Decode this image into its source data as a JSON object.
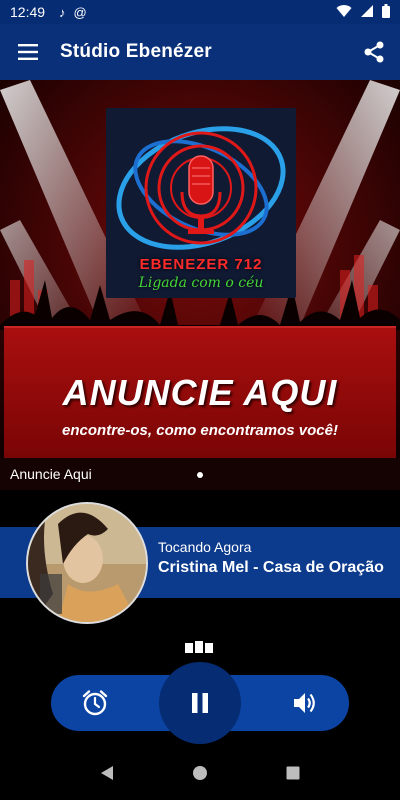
{
  "status_bar": {
    "time": "12:49",
    "icons": [
      "music-note-icon",
      "at-icon",
      "wifi-icon",
      "signal-icon",
      "battery-icon"
    ]
  },
  "app_bar": {
    "title": "Stúdio Ebenézer",
    "menu_icon": "hamburger-menu-icon",
    "share_icon": "share-icon"
  },
  "hero": {
    "logo_brand": "EBENEZER 712",
    "logo_tagline": "Ligada com o céu",
    "ad_title": "ANUNCIE AQUI",
    "ad_subtitle": "encontre-os, como encontramos você!",
    "caption": "Anuncie Aqui",
    "slide_index": 1
  },
  "now_playing": {
    "label": "Tocando Agora",
    "track": "Cristina Mel - Casa de Oração"
  },
  "controls": {
    "alarm_icon": "alarm-clock-icon",
    "pause_icon": "pause-icon",
    "volume_icon": "volume-icon"
  },
  "colors": {
    "app_bar": "#0a3079",
    "now_playing_bg": "#0c3a8c",
    "controls_bg": "#0b44a3",
    "pause_bg": "#062c74",
    "ad_red": "#a90f0f",
    "tagline_green": "#45d63a"
  }
}
